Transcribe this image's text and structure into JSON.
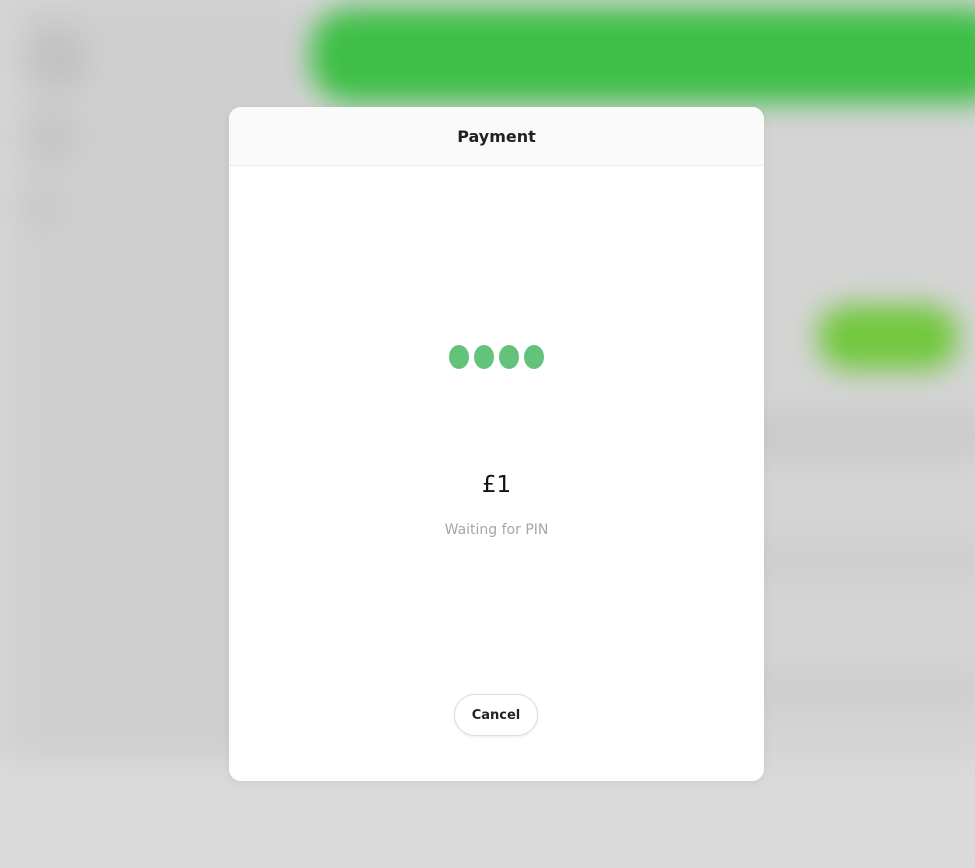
{
  "modal": {
    "title": "Payment",
    "pin_entered_digits": 4,
    "amount": "£1",
    "status": "Waiting for PIN",
    "cancel_label": "Cancel"
  },
  "colors": {
    "accent_green": "#63c37a",
    "background_brand_green": "#3fbf47",
    "status_text_gray": "#a6a6a6"
  }
}
